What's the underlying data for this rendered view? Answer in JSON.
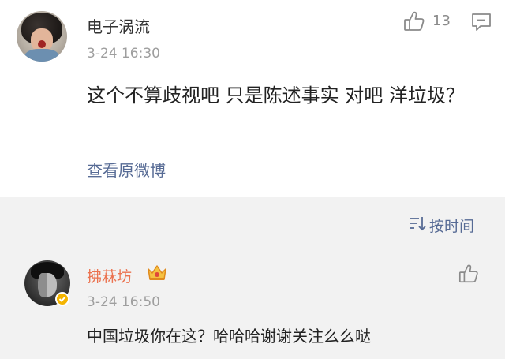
{
  "first_comment": {
    "username": "电子涡流",
    "time": "3-24 16:30",
    "like_count": "13",
    "text": "这个不算歧视吧 只是陈述事实 对吧 洋垃圾？",
    "view_original_label": "查看原微博",
    "avatar_icon": "user-avatar",
    "like_icon": "thumbs-up-icon",
    "comment_icon": "comment-icon"
  },
  "replies_header": {
    "sort_label": "按时间",
    "sort_icon": "sort-icon"
  },
  "reply": {
    "username": "拂菻坊",
    "badge_icon": "crown-icon",
    "verified_icon": "verified-badge-icon",
    "time": "3-24 16:50",
    "text": "中国垃圾你在这？哈哈哈谢谢关注么么哒",
    "like_icon": "thumbs-up-icon"
  },
  "colors": {
    "link": "#576b95",
    "username_highlight": "#eb7350",
    "secondary_text": "#9e9e9e",
    "background_section": "#f2f2f2"
  }
}
